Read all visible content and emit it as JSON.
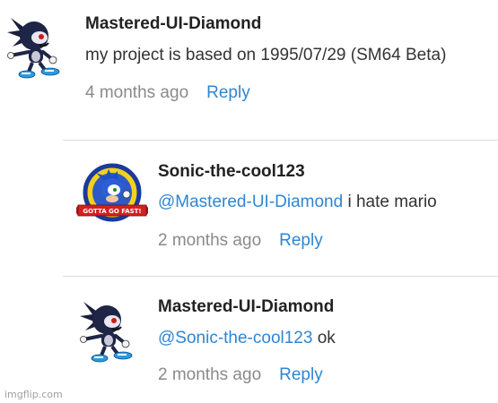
{
  "comments": [
    {
      "author": "Mastered-UI-Diamond",
      "mention": "",
      "text": "my project is based on 1995/07/29 (SM64 Beta)",
      "time": "4 months ago",
      "reply": "Reply",
      "avatar": "dark-sonic-avatar"
    },
    {
      "author": "Sonic-the-cool123",
      "mention": "@Mastered-UI-Diamond",
      "text": " i hate mario",
      "time": "2 months ago",
      "reply": "Reply",
      "avatar": "gotta-go-fast-avatar",
      "badge_text": "GOTTA GO FAST!"
    },
    {
      "author": "Mastered-UI-Diamond",
      "mention": "@Sonic-the-cool123",
      "text": " ok",
      "time": "2 months ago",
      "reply": "Reply",
      "avatar": "dark-sonic-avatar"
    }
  ],
  "watermark": "imgflip.com",
  "colors": {
    "link": "#2f86d1",
    "time": "#8a8a8a",
    "divider": "#dcdcdc"
  }
}
